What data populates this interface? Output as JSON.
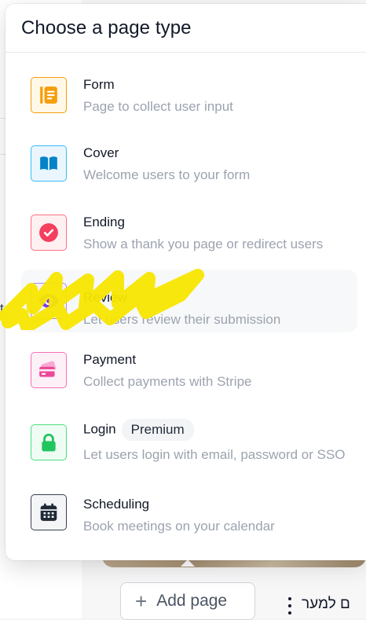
{
  "modal": {
    "title": "Choose a page type",
    "items": [
      {
        "key": "form",
        "title": "Form",
        "description": "Page to collect user input",
        "icon": "form-icon",
        "color": "#f59e0b",
        "bg": "#fff8e6",
        "border": "#f59e0b"
      },
      {
        "key": "cover",
        "title": "Cover",
        "description": "Welcome users to your form",
        "icon": "book-open-icon",
        "color": "#0284c7",
        "bg": "#eaf6fd",
        "border": "#38bdf8"
      },
      {
        "key": "ending",
        "title": "Ending",
        "description": "Show a thank you page or redirect users",
        "icon": "check-circle-icon",
        "color": "#f43f5e",
        "bg": "#fff0f2",
        "border": "#fb7185"
      },
      {
        "key": "review",
        "title": "Review",
        "description": "Let users review their submission",
        "icon": "eye-icon",
        "color": "#7c3aed",
        "bg": "#f5f1fe",
        "border": "#a78bfa"
      },
      {
        "key": "payment",
        "title": "Payment",
        "description": "Collect payments with Stripe",
        "icon": "credit-card-icon",
        "color": "#ec4899",
        "bg": "#fdf0f7",
        "border": "#f472b6"
      },
      {
        "key": "login",
        "title": "Login",
        "badge": "Premium",
        "description": "Let users login with email, password or SSO",
        "icon": "lock-icon",
        "color": "#22c55e",
        "bg": "#effcf3",
        "border": "#4ade80"
      },
      {
        "key": "scheduling",
        "title": "Scheduling",
        "description": "Book meetings on your calendar",
        "icon": "calendar-icon",
        "color": "#1f2937",
        "bg": "#f4f5f7",
        "border": "#374151"
      }
    ]
  },
  "background": {
    "add_page_label": "Add page",
    "edge_text": "t",
    "rtl_text": "ם למער"
  },
  "annotation": {
    "highlight_color": "#f7e600"
  }
}
